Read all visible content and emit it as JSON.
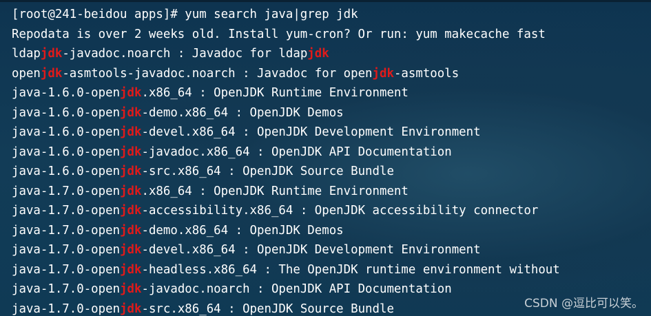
{
  "terminal": {
    "lines": [
      {
        "segments": [
          {
            "text": "[root@241-beidou apps]# yum search java|grep jdk",
            "highlight": false
          }
        ]
      },
      {
        "segments": [
          {
            "text": "Repodata is over 2 weeks old. Install yum-cron? Or run: yum makecache fast",
            "highlight": false
          }
        ]
      },
      {
        "segments": [
          {
            "text": "ldap",
            "highlight": false
          },
          {
            "text": "jdk",
            "highlight": true
          },
          {
            "text": "-javadoc.noarch : Javadoc for ldap",
            "highlight": false
          },
          {
            "text": "jdk",
            "highlight": true
          }
        ]
      },
      {
        "segments": [
          {
            "text": "open",
            "highlight": false
          },
          {
            "text": "jdk",
            "highlight": true
          },
          {
            "text": "-asmtools-javadoc.noarch : Javadoc for open",
            "highlight": false
          },
          {
            "text": "jdk",
            "highlight": true
          },
          {
            "text": "-asmtools",
            "highlight": false
          }
        ]
      },
      {
        "segments": [
          {
            "text": "java-1.6.0-open",
            "highlight": false
          },
          {
            "text": "jdk",
            "highlight": true
          },
          {
            "text": ".x86_64 : OpenJDK Runtime Environment",
            "highlight": false
          }
        ]
      },
      {
        "segments": [
          {
            "text": "java-1.6.0-open",
            "highlight": false
          },
          {
            "text": "jdk",
            "highlight": true
          },
          {
            "text": "-demo.x86_64 : OpenJDK Demos",
            "highlight": false
          }
        ]
      },
      {
        "segments": [
          {
            "text": "java-1.6.0-open",
            "highlight": false
          },
          {
            "text": "jdk",
            "highlight": true
          },
          {
            "text": "-devel.x86_64 : OpenJDK Development Environment",
            "highlight": false
          }
        ]
      },
      {
        "segments": [
          {
            "text": "java-1.6.0-open",
            "highlight": false
          },
          {
            "text": "jdk",
            "highlight": true
          },
          {
            "text": "-javadoc.x86_64 : OpenJDK API Documentation",
            "highlight": false
          }
        ]
      },
      {
        "segments": [
          {
            "text": "java-1.6.0-open",
            "highlight": false
          },
          {
            "text": "jdk",
            "highlight": true
          },
          {
            "text": "-src.x86_64 : OpenJDK Source Bundle",
            "highlight": false
          }
        ]
      },
      {
        "segments": [
          {
            "text": "java-1.7.0-open",
            "highlight": false
          },
          {
            "text": "jdk",
            "highlight": true
          },
          {
            "text": ".x86_64 : OpenJDK Runtime Environment",
            "highlight": false
          }
        ]
      },
      {
        "segments": [
          {
            "text": "java-1.7.0-open",
            "highlight": false
          },
          {
            "text": "jdk",
            "highlight": true
          },
          {
            "text": "-accessibility.x86_64 : OpenJDK accessibility connector",
            "highlight": false
          }
        ]
      },
      {
        "segments": [
          {
            "text": "java-1.7.0-open",
            "highlight": false
          },
          {
            "text": "jdk",
            "highlight": true
          },
          {
            "text": "-demo.x86_64 : OpenJDK Demos",
            "highlight": false
          }
        ]
      },
      {
        "segments": [
          {
            "text": "java-1.7.0-open",
            "highlight": false
          },
          {
            "text": "jdk",
            "highlight": true
          },
          {
            "text": "-devel.x86_64 : OpenJDK Development Environment",
            "highlight": false
          }
        ]
      },
      {
        "segments": [
          {
            "text": "java-1.7.0-open",
            "highlight": false
          },
          {
            "text": "jdk",
            "highlight": true
          },
          {
            "text": "-headless.x86_64 : The OpenJDK runtime environment without",
            "highlight": false
          }
        ]
      },
      {
        "segments": [
          {
            "text": "java-1.7.0-open",
            "highlight": false
          },
          {
            "text": "jdk",
            "highlight": true
          },
          {
            "text": "-javadoc.noarch : OpenJDK API Documentation",
            "highlight": false
          }
        ]
      },
      {
        "segments": [
          {
            "text": "java-1.7.0-open",
            "highlight": false
          },
          {
            "text": "jdk",
            "highlight": true
          },
          {
            "text": "-src.x86_64 : OpenJDK Source Bundle",
            "highlight": false
          }
        ]
      }
    ]
  },
  "watermark": {
    "text": "CSDN @逗比可以笑。"
  },
  "colors": {
    "background": "#123c57",
    "text": "#ffffff",
    "highlight": "#e01a1a"
  }
}
